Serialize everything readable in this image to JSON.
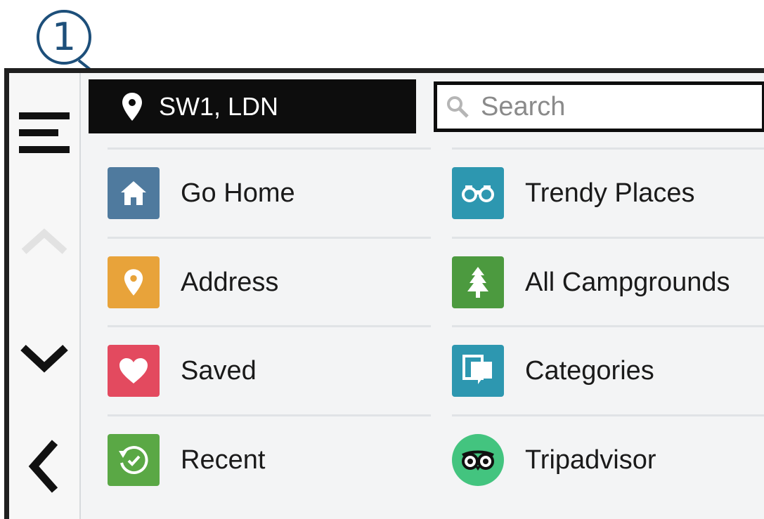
{
  "callout": {
    "number": "1"
  },
  "location": {
    "text": "SW1, LDN"
  },
  "search": {
    "placeholder": "Search"
  },
  "side_rail": {
    "menu_icon": "hamburger-menu-icon",
    "up_icon": "chevron-up-icon",
    "down_icon": "chevron-down-icon",
    "back_icon": "chevron-left-icon"
  },
  "menu": {
    "left": [
      {
        "label": "Go Home",
        "icon": "home-icon",
        "color": "#4f7a9e"
      },
      {
        "label": "Address",
        "icon": "location-pin-icon",
        "color": "#e8a33a"
      },
      {
        "label": "Saved",
        "icon": "heart-icon",
        "color": "#e34a5f"
      },
      {
        "label": "Recent",
        "icon": "history-icon",
        "color": "#5aa845"
      }
    ],
    "right": [
      {
        "label": "Trendy Places",
        "icon": "binoculars-icon",
        "color": "#2d97b0"
      },
      {
        "label": "All Campgrounds",
        "icon": "tree-icon",
        "color": "#4c9a3f"
      },
      {
        "label": "Categories",
        "icon": "categories-icon",
        "color": "#2d97b0"
      },
      {
        "label": "Tripadvisor",
        "icon": "tripadvisor-owl-icon",
        "color": "#43c47f"
      }
    ]
  }
}
